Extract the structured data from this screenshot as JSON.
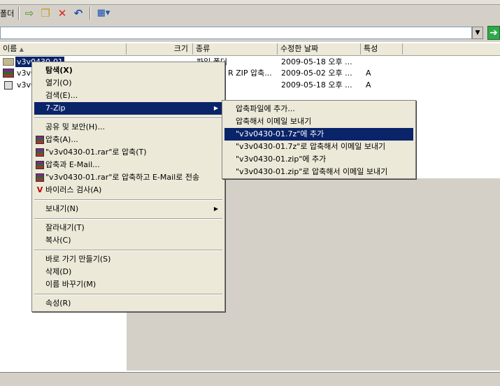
{
  "toolbar": {
    "label_fragment": "폴더"
  },
  "columns": {
    "name": "이름",
    "size": "크기",
    "type": "종류",
    "modified": "수정한 날짜",
    "attributes": "특성"
  },
  "files": [
    {
      "name": "v3v0430-01",
      "type": "파일 폴더",
      "modified": "2009-05-18 오후 ...",
      "attr": ""
    },
    {
      "name": "v3v0",
      "type": "R ZIP 압축...",
      "modified": "2009-05-02 오후 ...",
      "attr": "A"
    },
    {
      "name": "v3v0",
      "type": "",
      "modified": "2009-05-18 오후 ...",
      "attr": "A"
    }
  ],
  "context_menu": {
    "explore": "탐색(X)",
    "open": "열기(O)",
    "search": "검색(E)...",
    "seven_zip": "7-Zip",
    "sharing": "공유 및 보안(H)...",
    "compress": "압축(A)...",
    "compress_rar": "\"v3v0430-01.rar\"로 압축(T)",
    "compress_email": "압축과 E-Mail...",
    "compress_rar_email": "\"v3v0430-01.rar\"로 압축하고 E-Mail로 전송",
    "virus_scan": "바이러스 검사(A)",
    "send_to": "보내기(N)",
    "cut": "잘라내기(T)",
    "copy": "복사(C)",
    "shortcut": "바로 가기 만들기(S)",
    "delete": "삭제(D)",
    "rename": "이름 바꾸기(M)",
    "properties": "속성(R)"
  },
  "submenu_7zip": {
    "add_archive": "압축파일에 추가...",
    "compress_email": "압축해서 이메일 보내기",
    "add_7z": "\"v3v0430-01.7z\"에 추가",
    "add_7z_email": "\"v3v0430-01.7z\"로 압축해서 이메일 보내기",
    "add_zip": "\"v3v0430-01.zip\"에 추가",
    "add_zip_email": "\"v3v0430-01.zip\"로 압축해서 이메일 보내기"
  },
  "colors": {
    "selection": "#0a246a",
    "menu_bg": "#ece9d8",
    "chrome": "#d4d0c8"
  },
  "icons": [
    "folder-up-icon",
    "move-to-icon",
    "copy-to-icon",
    "delete-icon",
    "undo-icon",
    "views-icon",
    "folder-icon",
    "rar-archive-icon",
    "file-icon",
    "v3-icon",
    "go-icon"
  ]
}
